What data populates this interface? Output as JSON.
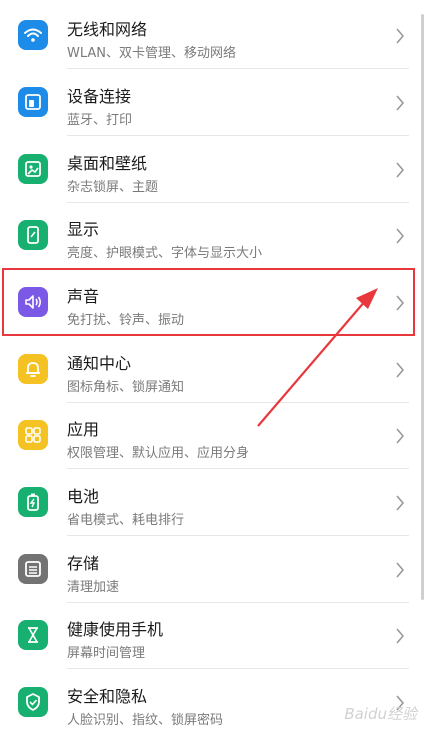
{
  "settings": {
    "items": [
      {
        "title": "无线和网络",
        "subtitle": "WLAN、双卡管理、移动网络",
        "icon": "wifi-icon",
        "color": "#1d8ce8"
      },
      {
        "title": "设备连接",
        "subtitle": "蓝牙、打印",
        "icon": "device-connection-icon",
        "color": "#1d8ce8"
      },
      {
        "title": "桌面和壁纸",
        "subtitle": "杂志锁屏、主题",
        "icon": "wallpaper-icon",
        "color": "#18b070"
      },
      {
        "title": "显示",
        "subtitle": "亮度、护眼模式、字体与显示大小",
        "icon": "display-icon",
        "color": "#18b070"
      },
      {
        "title": "声音",
        "subtitle": "免打扰、铃声、振动",
        "icon": "sound-icon",
        "color": "#7b59e6"
      },
      {
        "title": "通知中心",
        "subtitle": "图标角标、锁屏通知",
        "icon": "bell-icon",
        "color": "#f4c323"
      },
      {
        "title": "应用",
        "subtitle": "权限管理、默认应用、应用分身",
        "icon": "apps-icon",
        "color": "#f4c323"
      },
      {
        "title": "电池",
        "subtitle": "省电模式、耗电排行",
        "icon": "battery-icon",
        "color": "#18b070"
      },
      {
        "title": "存储",
        "subtitle": "清理加速",
        "icon": "storage-icon",
        "color": "#737373"
      },
      {
        "title": "健康使用手机",
        "subtitle": "屏幕时间管理",
        "icon": "hourglass-icon",
        "color": "#18b070"
      },
      {
        "title": "安全和隐私",
        "subtitle": "人脸识别、指纹、锁屏密码",
        "icon": "shield-icon",
        "color": "#18b070"
      }
    ]
  },
  "highlight": {
    "color": "#e8383d"
  },
  "watermark": "Baidu经验"
}
